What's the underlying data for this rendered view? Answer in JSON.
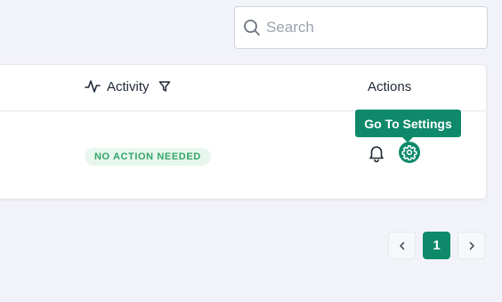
{
  "search": {
    "placeholder": "Search",
    "value": ""
  },
  "table": {
    "columns": {
      "activity": "Activity",
      "actions": "Actions"
    },
    "rows": [
      {
        "status": "NO ACTION NEEDED",
        "status_color": "#34a46a"
      }
    ]
  },
  "tooltip": {
    "text": "Go To Settings"
  },
  "pagination": {
    "current_page": "1"
  },
  "colors": {
    "accent": "#0e8a6a",
    "background": "#f2f3f8",
    "badge_bg": "#e8f7ee"
  },
  "icons": {
    "search": "search-icon",
    "activity": "activity-icon",
    "filter": "filter-icon",
    "notification": "bell-icon",
    "settings": "gear-icon",
    "previous": "chevron-left-icon",
    "next": "chevron-right-icon"
  }
}
